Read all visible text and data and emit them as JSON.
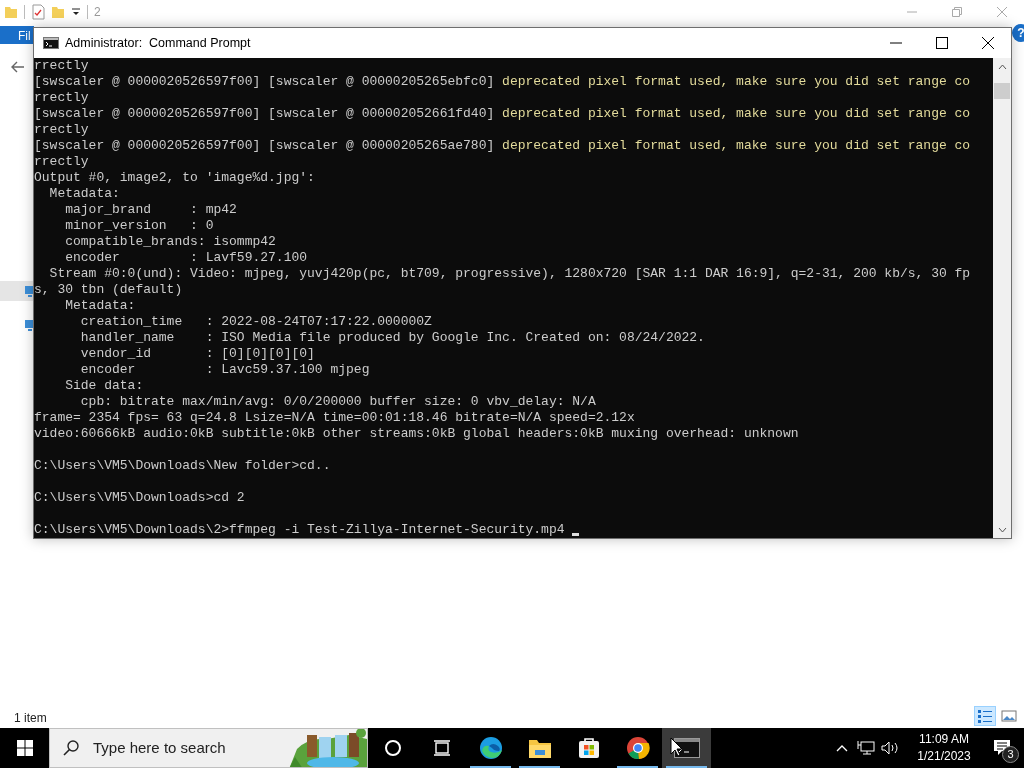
{
  "explorer": {
    "title": "2",
    "ribbon_tab": "Fil",
    "help": "?",
    "status": "1 item",
    "view_buttons": [
      {
        "kind": "details",
        "selected": true
      },
      {
        "kind": "thumbnails",
        "selected": false
      }
    ]
  },
  "console": {
    "title": "Administrator:  Command Prompt",
    "lines": [
      {
        "kind": "plain",
        "text": "rrectly"
      },
      {
        "kind": "warning",
        "text": "[swscaler @ 0000020526597f00] [swscaler @ 00000205265ebfc0] ",
        "message": "deprecated pixel format used, make sure you did set range co"
      },
      {
        "kind": "plain",
        "text": "rrectly"
      },
      {
        "kind": "warning",
        "text": "[swscaler @ 0000020526597f00] [swscaler @ 000002052661fd40] ",
        "message": "deprecated pixel format used, make sure you did set range co"
      },
      {
        "kind": "plain",
        "text": "rrectly"
      },
      {
        "kind": "warning",
        "text": "[swscaler @ 0000020526597f00] [swscaler @ 00000205265ae780] ",
        "message": "deprecated pixel format used, make sure you did set range co"
      },
      {
        "kind": "plain",
        "text": "rrectly"
      },
      {
        "kind": "plain",
        "text": "Output #0, image2, to 'image%d.jpg':"
      },
      {
        "kind": "plain",
        "text": "  Metadata:"
      },
      {
        "kind": "plain",
        "text": "    major_brand     : mp42"
      },
      {
        "kind": "plain",
        "text": "    minor_version   : 0"
      },
      {
        "kind": "plain",
        "text": "    compatible_brands: isommp42"
      },
      {
        "kind": "plain",
        "text": "    encoder         : Lavf59.27.100"
      },
      {
        "kind": "plain",
        "text": "  Stream #0:0(und): Video: mjpeg, yuvj420p(pc, bt709, progressive), 1280x720 [SAR 1:1 DAR 16:9], q=2-31, 200 kb/s, 30 fp"
      },
      {
        "kind": "plain",
        "text": "s, 30 tbn (default)"
      },
      {
        "kind": "plain",
        "text": "    Metadata:"
      },
      {
        "kind": "plain",
        "text": "      creation_time   : 2022-08-24T07:17:22.000000Z"
      },
      {
        "kind": "plain",
        "text": "      handler_name    : ISO Media file produced by Google Inc. Created on: 08/24/2022."
      },
      {
        "kind": "plain",
        "text": "      vendor_id       : [0][0][0][0]"
      },
      {
        "kind": "plain",
        "text": "      encoder         : Lavc59.37.100 mjpeg"
      },
      {
        "kind": "plain",
        "text": "    Side data:"
      },
      {
        "kind": "plain",
        "text": "      cpb: bitrate max/min/avg: 0/0/200000 buffer size: 0 vbv_delay: N/A"
      },
      {
        "kind": "plain",
        "text": "frame= 2354 fps= 63 q=24.8 Lsize=N/A time=00:01:18.46 bitrate=N/A speed=2.12x"
      },
      {
        "kind": "plain",
        "text": "video:60666kB audio:0kB subtitle:0kB other streams:0kB global headers:0kB muxing overhead: unknown"
      },
      {
        "kind": "blank"
      },
      {
        "kind": "plain",
        "text": "C:\\Users\\VM5\\Downloads\\New folder>cd.."
      },
      {
        "kind": "blank"
      },
      {
        "kind": "plain",
        "text": "C:\\Users\\VM5\\Downloads>cd 2"
      },
      {
        "kind": "blank"
      },
      {
        "kind": "prompt",
        "text": "C:\\Users\\VM5\\Downloads\\2>ffmpeg -i Test-Zillya-Internet-Security.mp4 "
      }
    ]
  },
  "taskbar": {
    "search": {
      "placeholder": "Type here to search"
    },
    "apps": [
      {
        "kind": "cortana",
        "open": false,
        "selected": false
      },
      {
        "kind": "taskview",
        "open": false,
        "selected": false
      },
      {
        "kind": "edge",
        "open": true,
        "selected": false
      },
      {
        "kind": "explorer",
        "open": true,
        "selected": false
      },
      {
        "kind": "store",
        "open": false,
        "selected": false
      },
      {
        "kind": "chrome",
        "open": true,
        "selected": false
      },
      {
        "kind": "terminal",
        "open": true,
        "selected": true
      }
    ],
    "clock": {
      "time": "11:09 AM",
      "date": "1/21/2023"
    },
    "notifications": {
      "count": "3"
    }
  }
}
